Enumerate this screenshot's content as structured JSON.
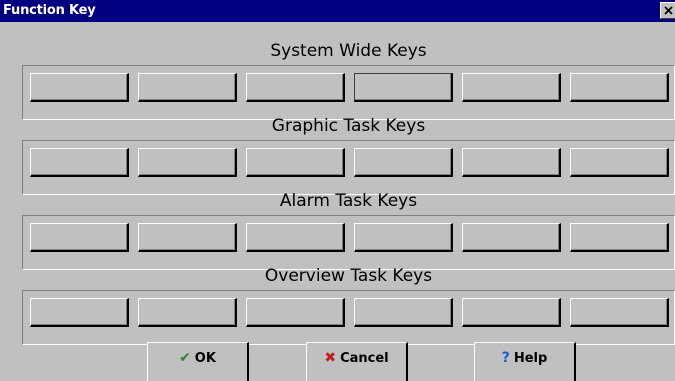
{
  "window": {
    "title": "Function Key",
    "close_glyph": "×"
  },
  "groups": [
    {
      "title": "System Wide Keys",
      "key_labels": [
        "",
        "",
        "",
        "",
        "",
        ""
      ]
    },
    {
      "title": "Graphic Task Keys",
      "key_labels": [
        "",
        "",
        "",
        "",
        "",
        ""
      ]
    },
    {
      "title": "Alarm Task Keys",
      "key_labels": [
        "",
        "",
        "",
        "",
        "",
        ""
      ]
    },
    {
      "title": "Overview Task Keys",
      "key_labels": [
        "",
        "",
        "",
        "",
        "",
        ""
      ]
    }
  ],
  "buttons": {
    "ok": {
      "label": "OK",
      "icon": "checkmark-icon"
    },
    "cancel": {
      "label": "Cancel",
      "icon": "x-mark-icon"
    },
    "help": {
      "label": "Help",
      "icon": "question-mark-icon"
    }
  },
  "colors": {
    "titlebar": "#000080",
    "face": "#c0c0c0"
  }
}
